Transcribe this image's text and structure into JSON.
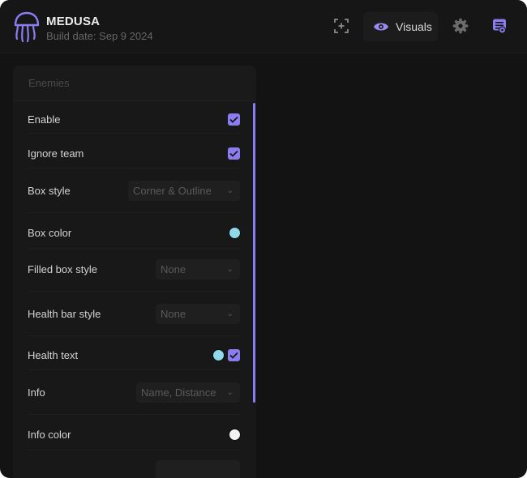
{
  "app": {
    "name": "MEDUSA",
    "build_date": "Build date: Sep 9 2024"
  },
  "toolbar": {
    "active_tab_label": "Visuals"
  },
  "colors": {
    "accent": "#8b7cf0",
    "cyan_dot": "#8fd9ea",
    "white_dot": "#f2f2f2"
  },
  "icons": {
    "logo": "jellyfish-logo",
    "aim": "crosshair-icon",
    "visuals": "eye-icon",
    "settings": "gear-icon",
    "config": "config-icon"
  },
  "panel": {
    "title": "Enemies",
    "rows": [
      {
        "label": "Enable",
        "checked": true
      },
      {
        "label": "Ignore team",
        "checked": true
      },
      {
        "label": "Box style",
        "value": "Corner & Outline"
      },
      {
        "label": "Box color"
      },
      {
        "label": "Filled box style",
        "value": "None"
      },
      {
        "label": "Health bar style",
        "value": "None"
      },
      {
        "label": "Health text",
        "checked": true
      },
      {
        "label": "Info",
        "value": "Name, Distance"
      },
      {
        "label": "Info color"
      }
    ]
  }
}
